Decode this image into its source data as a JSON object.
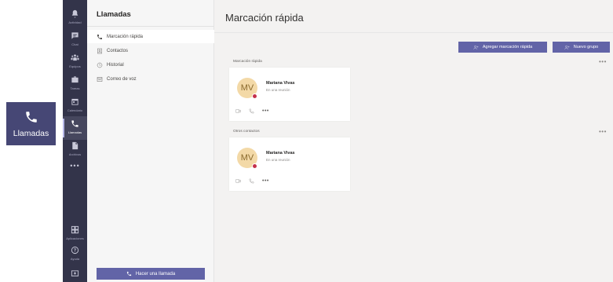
{
  "callout": {
    "label": "Llamadas",
    "icon": "phone-icon"
  },
  "rail": {
    "items": [
      {
        "label": "Actividad",
        "icon": "bell-icon"
      },
      {
        "label": "Chat",
        "icon": "chat-icon"
      },
      {
        "label": "Equipos",
        "icon": "teams-icon"
      },
      {
        "label": "Tareas",
        "icon": "briefcase-icon"
      },
      {
        "label": "Calendario",
        "icon": "calendar-icon"
      },
      {
        "label": "Llamadas",
        "icon": "phone-icon"
      },
      {
        "label": "Archivos",
        "icon": "file-icon"
      }
    ],
    "more": "•••",
    "bottom": [
      {
        "label": "Aplicaciones",
        "icon": "apps-icon"
      },
      {
        "label": "Ayuda",
        "icon": "help-icon"
      }
    ]
  },
  "list": {
    "title": "Llamadas",
    "items": [
      {
        "label": "Marcación rápida",
        "icon": "phone-icon"
      },
      {
        "label": "Contactos",
        "icon": "contacts-icon"
      },
      {
        "label": "Historial",
        "icon": "history-icon"
      },
      {
        "label": "Correo de voz",
        "icon": "voicemail-icon"
      }
    ],
    "call_button": "Hacer una llamada"
  },
  "main": {
    "title": "Marcación rápida",
    "add_speed_dial": "Agregar marcación rápida",
    "new_group": "Nuevo grupo",
    "sections": [
      {
        "label": "Marcación rápida",
        "more": "•••",
        "card": {
          "initials": "MV",
          "name": "Mariana Vivas",
          "status": "En una reunión"
        }
      },
      {
        "label": "Otros contactos",
        "more": "•••",
        "card": {
          "initials": "MV",
          "name": "Mariana Vivas",
          "status": "En una reunión"
        }
      }
    ],
    "card_more": "•••"
  },
  "colors": {
    "accent": "#6264a7",
    "rail": "#33344a",
    "busy": "#c4314b",
    "avatar_bg": "#f3d9a7"
  }
}
